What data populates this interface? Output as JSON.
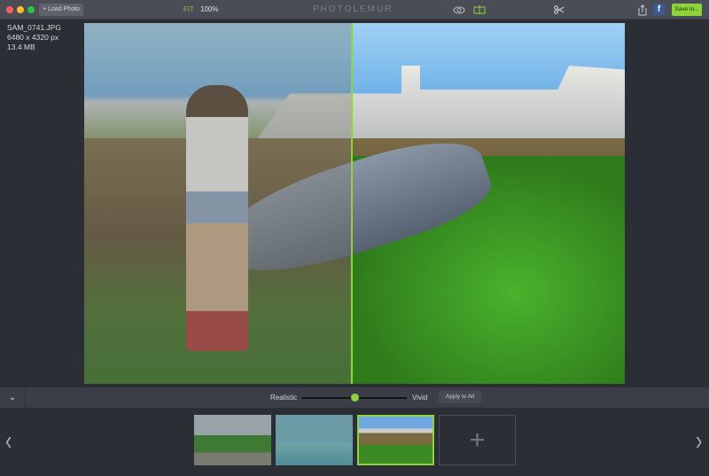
{
  "titlebar": {
    "load_photo": "+ Load Photo",
    "fit": "FIT",
    "zoom": "100%",
    "logo": "PHOTOLEMUR",
    "save": "Save to...",
    "facebook": "f"
  },
  "file": {
    "name": "SAM_0741.JPG",
    "dimensions": "6480 x 4320  px",
    "size": "13.4 MB"
  },
  "controls": {
    "left_label": "Realistic",
    "right_label": "Vivid",
    "slider_value": 0.5,
    "apply": "Apply to All"
  },
  "thumbnails": [
    {
      "name": "ferris-wheel-park",
      "selected": false
    },
    {
      "name": "pink-bridge",
      "selected": false
    },
    {
      "name": "girl-whale-sculpture",
      "selected": true
    }
  ],
  "add_symbol": "+",
  "nav": {
    "prev": "‹",
    "next": "›"
  },
  "colors": {
    "accent": "#8fd43c"
  }
}
